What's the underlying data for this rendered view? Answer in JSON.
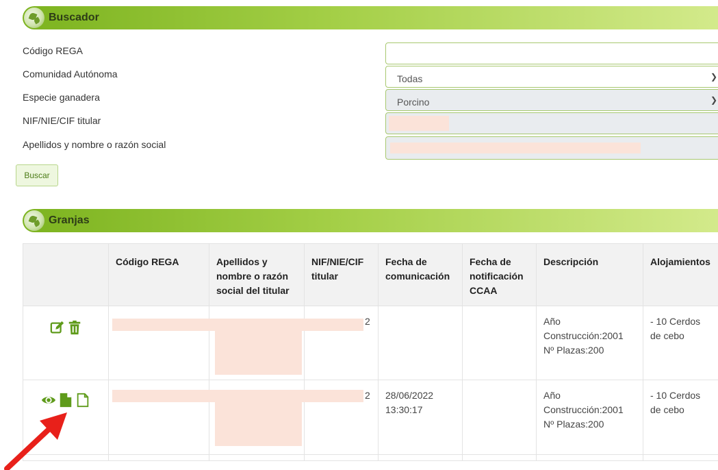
{
  "search": {
    "title": "Buscador",
    "fields": [
      {
        "label": "Código REGA",
        "value": ""
      },
      {
        "label": "Comunidad Autónoma",
        "value": "Todas"
      },
      {
        "label": "Especie ganadera",
        "value": "Porcino"
      },
      {
        "label": "NIF/NIE/CIF titular",
        "value": ""
      },
      {
        "label": "Apellidos y nombre o razón social",
        "value": ""
      }
    ],
    "button": "Buscar"
  },
  "farms": {
    "title": "Granjas",
    "columns": [
      "",
      "Código REGA",
      "Apellidos y nombre o razón social del titular",
      "NIF/NIE/CIF titular",
      "Fecha de comunicación",
      "Fecha de notificación CCAA",
      "Descripción",
      "Alojamientos"
    ],
    "rows": [
      {
        "nif_suffix": "2",
        "fecha_comunicacion": "",
        "fecha_notificacion": "",
        "descripcion": [
          "Año",
          "Construcción:2001",
          "Nº Plazas:200"
        ],
        "alojamientos": [
          "- 10 Cerdos",
          "de cebo"
        ],
        "actions": [
          "edit-icon",
          "trash-icon"
        ]
      },
      {
        "nif_suffix": "2",
        "fecha_comunicacion": [
          "28/06/2022",
          "13:30:17"
        ],
        "fecha_notificacion": "",
        "descripcion": [
          "Año",
          "Construcción:2001",
          "Nº Plazas:200"
        ],
        "alojamientos": [
          "- 10 Cerdos",
          "de cebo"
        ],
        "actions": [
          "eye-icon",
          "document-filled-icon",
          "document-outline-icon"
        ]
      }
    ]
  },
  "colors": {
    "accent_green": "#7cb31f",
    "icon_green": "#5f9b1b",
    "redaction": "#fbe3d9",
    "annotation_arrow": "#e8201a"
  }
}
